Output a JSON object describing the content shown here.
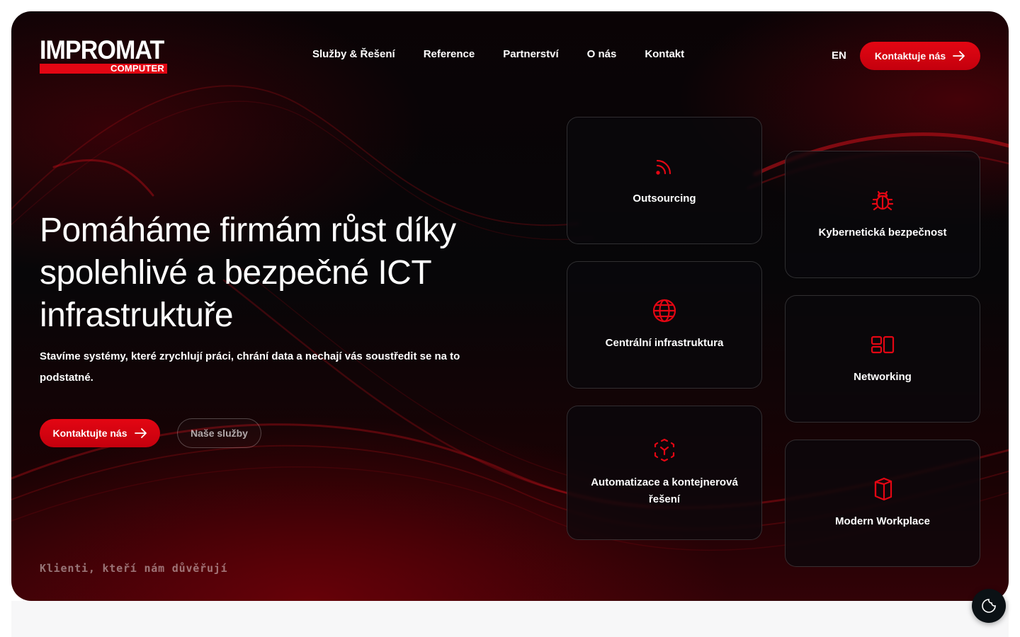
{
  "logo": {
    "top": "IMPROMAT",
    "bottom": "COMPUTER"
  },
  "nav": {
    "items": [
      {
        "label": "Služby & Řešení"
      },
      {
        "label": "Reference"
      },
      {
        "label": "Partnerství"
      },
      {
        "label": "O nás"
      },
      {
        "label": "Kontakt"
      }
    ],
    "lang": "EN",
    "cta_label": "Kontaktuje nás"
  },
  "hero": {
    "headline": "Pomáháme firmám růst díky spolehlivé a bezpečné ICT infrastruktuře",
    "subtext": "Stavíme systémy, které zrychlují práci, chrání data a nechají vás soustředit se na to podstatné.",
    "primary_button": "Kontaktujte nás",
    "secondary_button": "Naše služby",
    "clients_label": "Klienti, kteří nám důvěřují"
  },
  "cards": [
    {
      "label": "Outsourcing",
      "icon": "rss-icon"
    },
    {
      "label": "Centrální infrastruktura",
      "icon": "globe-icon"
    },
    {
      "label": "Automatizace a kontejnerová řešení",
      "icon": "container-icon"
    },
    {
      "label": "Kybernetická bezpečnost",
      "icon": "bug-icon"
    },
    {
      "label": "Networking",
      "icon": "layout-icon"
    },
    {
      "label": "Modern Workplace",
      "icon": "office-icon"
    }
  ],
  "colors": {
    "accent": "#e30613",
    "background": "#070608",
    "text": "#ffffff"
  }
}
